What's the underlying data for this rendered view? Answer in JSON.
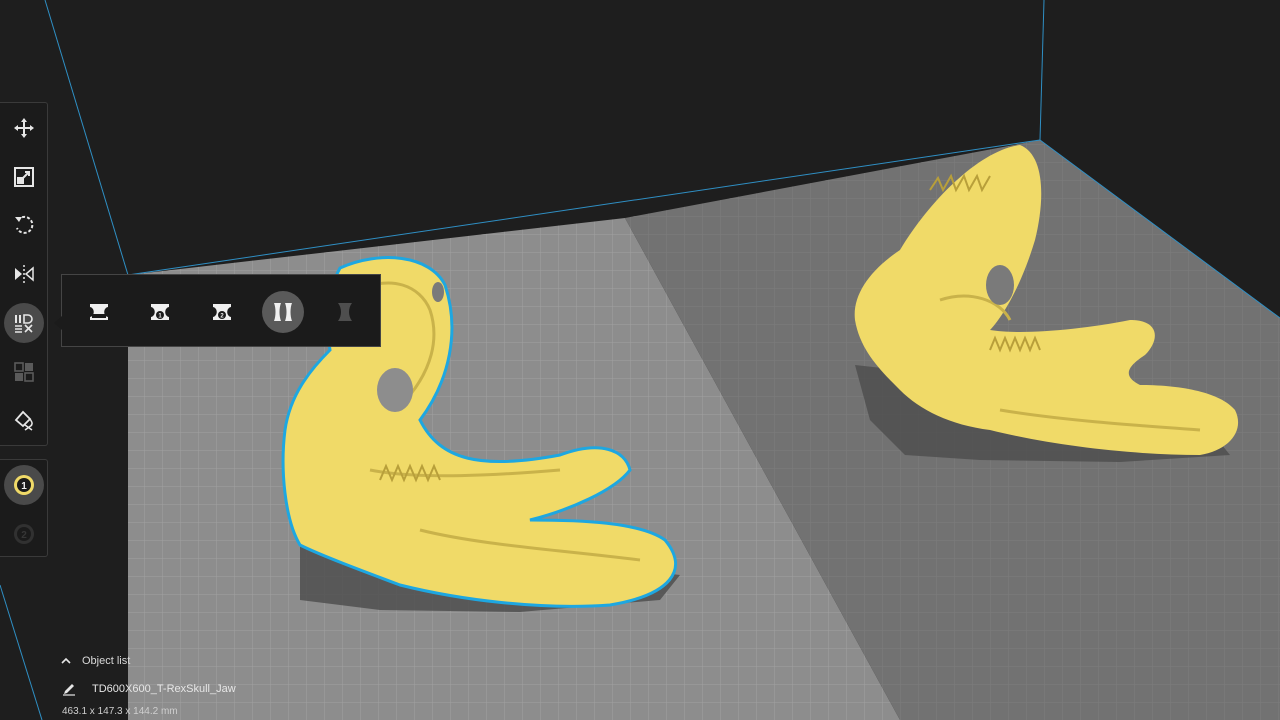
{
  "viewport": {
    "background_color": "#1e1e1e",
    "build_plate_color": "#8c8c8c",
    "build_plate_shade_color": "#6f6f6f",
    "model_color": "#f0da68",
    "selection_outline_color": "#1ea7e1",
    "boundary_line_color": "#2f8fc4"
  },
  "toolbar": {
    "tools": [
      {
        "name": "move",
        "icon": "move-icon"
      },
      {
        "name": "scale",
        "icon": "scale-icon"
      },
      {
        "name": "rotate",
        "icon": "rotate-icon"
      },
      {
        "name": "mirror",
        "icon": "mirror-icon"
      },
      {
        "name": "per-model-settings",
        "icon": "per-model-settings-icon",
        "active": true
      },
      {
        "name": "support-blocker",
        "icon": "support-blocker-icon",
        "disabled": true
      },
      {
        "name": "paint",
        "icon": "paint-icon"
      }
    ],
    "extruders": [
      {
        "label": "1",
        "active": true
      },
      {
        "label": "2",
        "disabled": true
      }
    ]
  },
  "per_model_popup": {
    "options": [
      {
        "name": "normal-model",
        "icon": "normal-model-icon"
      },
      {
        "name": "extruder-1-model",
        "icon": "extruder-1-model-icon",
        "badge": "1"
      },
      {
        "name": "extruder-2-model",
        "icon": "extruder-2-model-icon",
        "badge": "2"
      },
      {
        "name": "mesh-type-active",
        "icon": "dual-mesh-icon",
        "active": true
      },
      {
        "name": "mesh-type-disabled",
        "icon": "anti-overhang-icon",
        "disabled": true
      }
    ]
  },
  "object_panel": {
    "toggle_label": "Object list",
    "object_name": "TD600X600_T-RexSkull_Jaw",
    "dimensions": "463.1 x 147.3 x 144.2 mm"
  }
}
